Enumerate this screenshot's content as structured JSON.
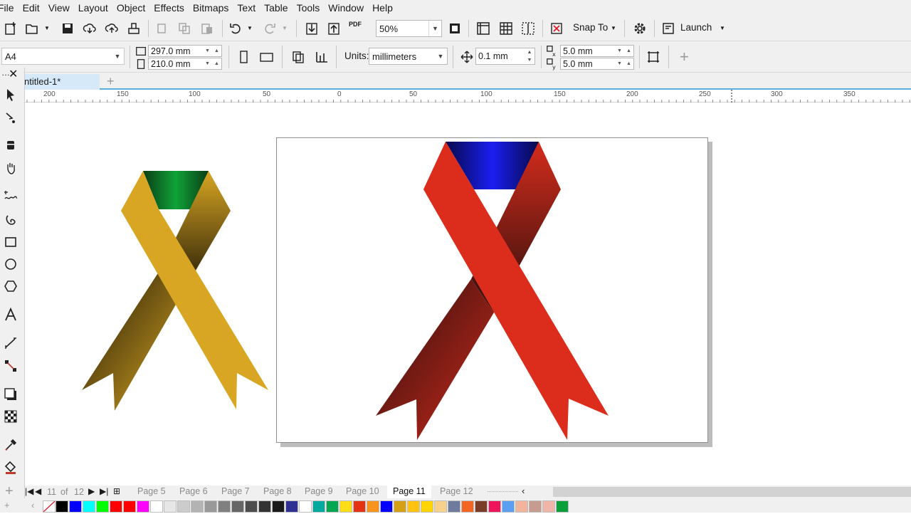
{
  "menu": [
    "File",
    "Edit",
    "View",
    "Layout",
    "Object",
    "Effects",
    "Bitmaps",
    "Text",
    "Table",
    "Tools",
    "Window",
    "Help"
  ],
  "toolbar1": {
    "zoom": "50%",
    "snap_to": "Snap To",
    "launch": "Launch",
    "pdf_label": "PDF"
  },
  "toolbar2": {
    "page_size": "A4",
    "width": "297.0 mm",
    "height": "210.0 mm",
    "units_label": "Units:",
    "units": "millimeters",
    "nudge": "0.1 mm",
    "dup_x": "5.0 mm",
    "dup_y": "5.0 mm"
  },
  "document": {
    "tab_title": "ntitled-1*"
  },
  "ruler": {
    "labels": [
      "200",
      "150",
      "100",
      "50",
      "0",
      "50",
      "100",
      "150",
      "200",
      "250",
      "300",
      "350"
    ]
  },
  "page_nav": {
    "current": "11",
    "of_label": "of",
    "total": "12",
    "tabs": [
      "Page 5",
      "Page 6",
      "Page 7",
      "Page 8",
      "Page 9",
      "Page 10",
      "Page 11",
      "Page 12"
    ],
    "active_tab": "Page 11"
  },
  "colors": {
    "ribbon_gold": "#d8a622",
    "ribbon_green": "#0d8a2c",
    "ribbon_red": "#dc2c1b",
    "ribbon_blue": "#1a1ed6",
    "tab_underline": "#5aaed9"
  },
  "palette": [
    "#000000",
    "#0000ff",
    "#00ffff",
    "#00ff00",
    "#ff0000",
    "#ff0000",
    "#ff00ff",
    "#ffffff",
    "#e6e6e6",
    "#cccccc",
    "#b3b3b3",
    "#999999",
    "#808080",
    "#666666",
    "#4d4d4d",
    "#333333",
    "#1a1a1a",
    "#2e3192",
    "#ffffff",
    "#00a99d",
    "#00a651",
    "#ffde17",
    "#e53212",
    "#f7941d",
    "#0000ff",
    "#d4a017",
    "#ffc20e",
    "#ffd400",
    "#f7d08a",
    "#6f7b9c",
    "#f26522",
    "#7a3c26",
    "#ed145b",
    "#5c9ef0",
    "#f2b59b",
    "#c69c8f",
    "#efb5a8",
    "#0d9e3c"
  ],
  "icons": [
    "new-document-icon",
    "open-icon",
    "save-icon",
    "cloud-import-icon",
    "cloud-export-icon",
    "print-icon",
    "cut-icon",
    "copy-icon",
    "paste-icon",
    "undo-icon",
    "redo-icon",
    "import-icon",
    "export-icon",
    "pdf-icon",
    "full-screen-icon",
    "rulers-icon",
    "grid-icon",
    "guidelines-icon",
    "snap-icon",
    "gear-icon",
    "launch-icon"
  ]
}
